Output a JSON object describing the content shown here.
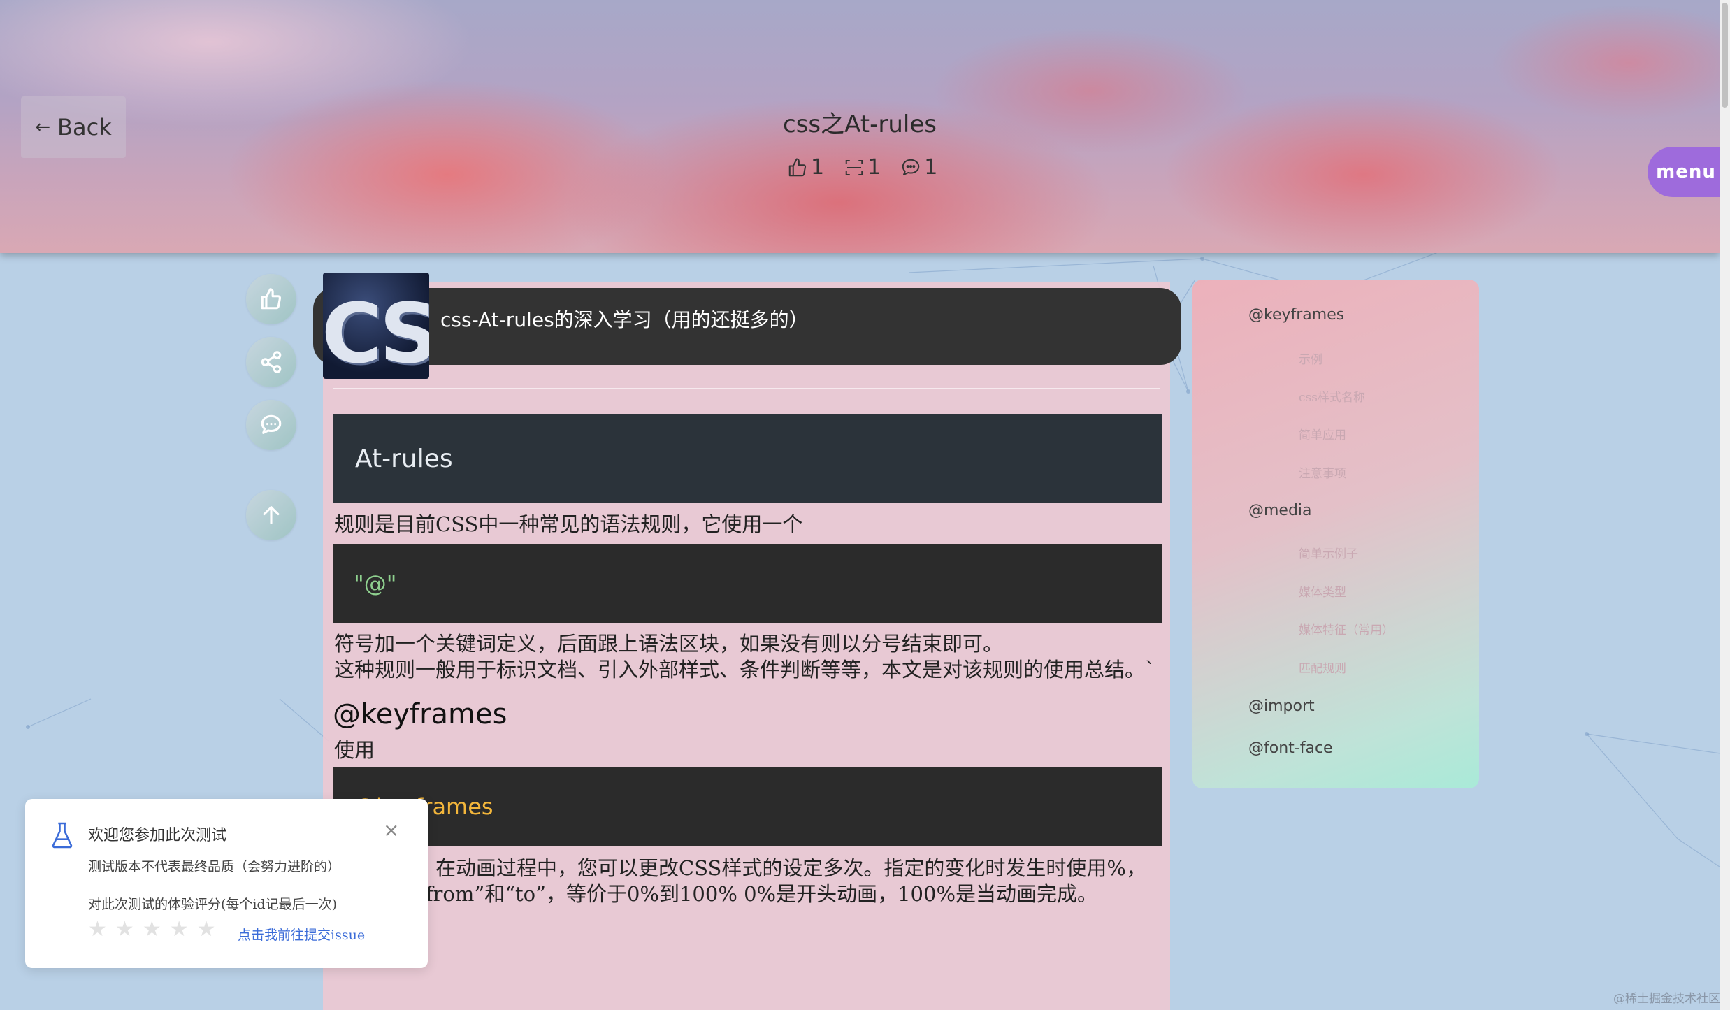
{
  "header": {
    "back_label": "Back",
    "title": "css之At-rules",
    "likes": "1",
    "collects": "1",
    "comments": "1",
    "menu_label": "menu"
  },
  "article": {
    "head_title": "css-At-rules的深入学习（用的还挺多的）",
    "logo_text": "CSS",
    "h1": "At-rules",
    "p1": "规则是目前CSS中一种常见的语法规则，它使用一个",
    "code1": "\"@\"",
    "p2": "符号加一个关键词定义，后面跟上语法区块，如果没有则以分号结束即可。",
    "p3": "这种规则一般用于标识文档、引入外部样式、条件判断等等，本文是对该规则的使用总结。`",
    "h2": "@keyframes",
    "p4": "使用",
    "code2": "@keyframes",
    "p5": "定义动画。在动画过程中，您可以更改CSS样式的设定多次。指定的变化时发生时使用%，或关键字“from”和“to”，等价于0%到100% 0%是开头动画，100%是当动画完成。"
  },
  "toc": {
    "items": [
      {
        "label": "@keyframes",
        "subs": [
          "示例",
          "css样式名称",
          "简单应用",
          "注意事项"
        ]
      },
      {
        "label": "@media",
        "subs": [
          "简单示例子",
          "媒体类型",
          "媒体特征（常用）",
          "匹配规则"
        ]
      },
      {
        "label": "@import",
        "subs": []
      },
      {
        "label": "@font-face",
        "subs": []
      }
    ]
  },
  "popup": {
    "title": "欢迎您参加此次测试",
    "line1": "测试版本不代表最终品质（会努力进阶的）",
    "line2": "对此次测试的体验评分(每个id记最后一次)",
    "link": "点击我前往提交issue",
    "rating": 0
  },
  "watermark": "@稀土掘金技术社区",
  "colors": {
    "menu": "#9e6bdc",
    "article_bg": "#ecc8d2",
    "code_bg": "#2b2b2b",
    "link": "#3a6bd8"
  }
}
